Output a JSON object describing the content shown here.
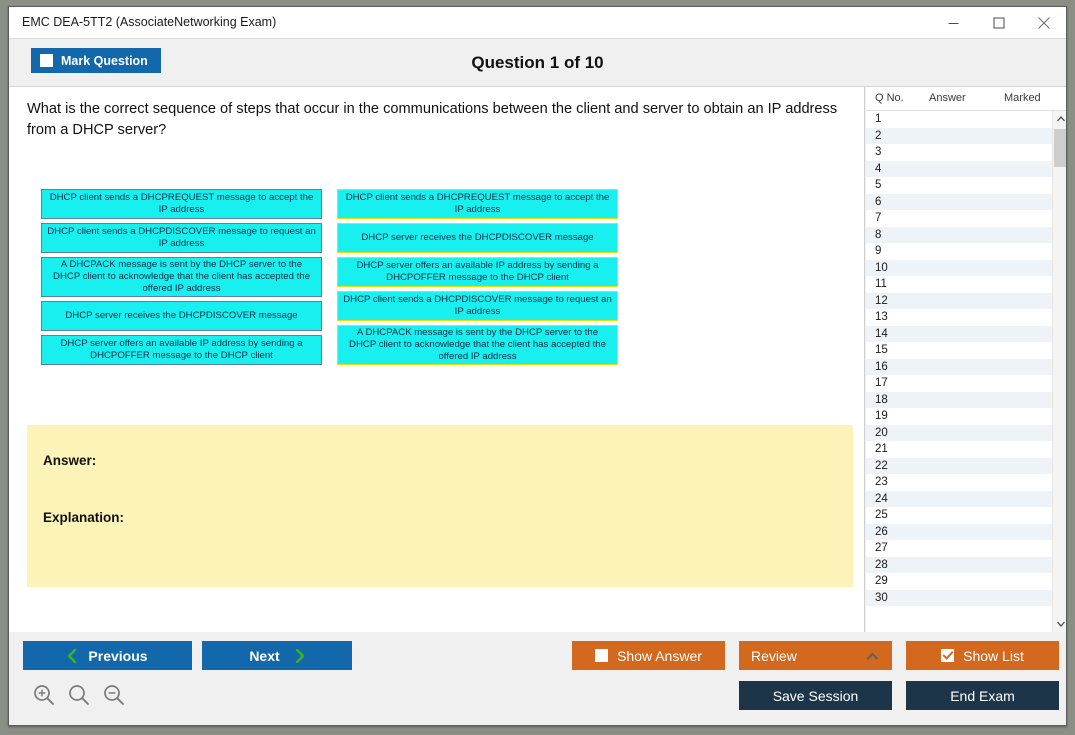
{
  "window": {
    "title": "EMC DEA-5TT2 (AssociateNetworking Exam)",
    "minimize_icon": "minimize-icon",
    "maximize_icon": "maximize-icon",
    "close_icon": "close-icon"
  },
  "header": {
    "mark_question_label": "Mark Question",
    "mark_question_checked": false,
    "question_title": "Question 1 of 10"
  },
  "question": {
    "text": "What is the correct sequence of steps that occur in the communications between the client and server to obtain an IP address from a DHCP server?"
  },
  "options": {
    "left_column": [
      {
        "text": "DHCP client sends a DHCPREQUEST message to accept the IP address",
        "lines": 2
      },
      {
        "text": "DHCP client sends a DHCPDISCOVER message to request an IP address",
        "lines": 2
      },
      {
        "text": "A DHCPACK message is sent by the DHCP server to the DHCP client to acknowledge that the client has accepted the offered IP address",
        "lines": 3
      },
      {
        "text": "DHCP server receives the DHCPDISCOVER message",
        "lines": 2
      },
      {
        "text": "DHCP server offers an available IP address by sending a DHCPOFFER message to the DHCP client",
        "lines": 2
      }
    ],
    "right_column": [
      {
        "text": "DHCP client sends a DHCPREQUEST message to accept the IP address",
        "lines": 2
      },
      {
        "text": "DHCP server receives the DHCPDISCOVER message",
        "lines": 2
      },
      {
        "text": "DHCP server offers an available IP address by sending a DHCPOFFER message to the DHCP client",
        "lines": 2
      },
      {
        "text": "DHCP client sends a DHCPDISCOVER message to request an IP address",
        "lines": 2
      },
      {
        "text": "A DHCPACK message is sent by the DHCP server to the DHCP client to acknowledge that the client has accepted the offered IP address",
        "lines": 3
      }
    ]
  },
  "answer_panel": {
    "answer_label": "Answer:",
    "explanation_label": "Explanation:",
    "answer_value": "",
    "explanation_value": ""
  },
  "question_list": {
    "columns": [
      "Q No.",
      "Answer",
      "Marked"
    ],
    "rows": [
      {
        "no": "1",
        "answer": "",
        "marked": ""
      },
      {
        "no": "2",
        "answer": "",
        "marked": ""
      },
      {
        "no": "3",
        "answer": "",
        "marked": ""
      },
      {
        "no": "4",
        "answer": "",
        "marked": ""
      },
      {
        "no": "5",
        "answer": "",
        "marked": ""
      },
      {
        "no": "6",
        "answer": "",
        "marked": ""
      },
      {
        "no": "7",
        "answer": "",
        "marked": ""
      },
      {
        "no": "8",
        "answer": "",
        "marked": ""
      },
      {
        "no": "9",
        "answer": "",
        "marked": ""
      },
      {
        "no": "10",
        "answer": "",
        "marked": ""
      },
      {
        "no": "11",
        "answer": "",
        "marked": ""
      },
      {
        "no": "12",
        "answer": "",
        "marked": ""
      },
      {
        "no": "13",
        "answer": "",
        "marked": ""
      },
      {
        "no": "14",
        "answer": "",
        "marked": ""
      },
      {
        "no": "15",
        "answer": "",
        "marked": ""
      },
      {
        "no": "16",
        "answer": "",
        "marked": ""
      },
      {
        "no": "17",
        "answer": "",
        "marked": ""
      },
      {
        "no": "18",
        "answer": "",
        "marked": ""
      },
      {
        "no": "19",
        "answer": "",
        "marked": ""
      },
      {
        "no": "20",
        "answer": "",
        "marked": ""
      },
      {
        "no": "21",
        "answer": "",
        "marked": ""
      },
      {
        "no": "22",
        "answer": "",
        "marked": ""
      },
      {
        "no": "23",
        "answer": "",
        "marked": ""
      },
      {
        "no": "24",
        "answer": "",
        "marked": ""
      },
      {
        "no": "25",
        "answer": "",
        "marked": ""
      },
      {
        "no": "26",
        "answer": "",
        "marked": ""
      },
      {
        "no": "27",
        "answer": "",
        "marked": ""
      },
      {
        "no": "28",
        "answer": "",
        "marked": ""
      },
      {
        "no": "29",
        "answer": "",
        "marked": ""
      },
      {
        "no": "30",
        "answer": "",
        "marked": ""
      }
    ],
    "scroll_up_icon": "chevron-up-icon",
    "scroll_down_icon": "chevron-down-icon"
  },
  "toolbar": {
    "previous_label": "Previous",
    "next_label": "Next",
    "show_answer_label": "Show Answer",
    "show_answer_checked": false,
    "review_label": "Review",
    "show_list_label": "Show List",
    "show_list_checked": true,
    "save_session_label": "Save Session",
    "end_exam_label": "End Exam",
    "zoom_in_icon": "zoom-in-icon",
    "zoom_reset_icon": "search-icon",
    "zoom_out_icon": "zoom-out-icon"
  },
  "colors": {
    "primary_blue": "#1368ac",
    "accent_orange": "#d2691e",
    "navy": "#1d3549",
    "option_cyan": "#18f0f0",
    "answer_panel_yellow": "#fcf3b8",
    "green_chevron": "#3cb521",
    "selected_border_yellow": "#e8e000"
  }
}
